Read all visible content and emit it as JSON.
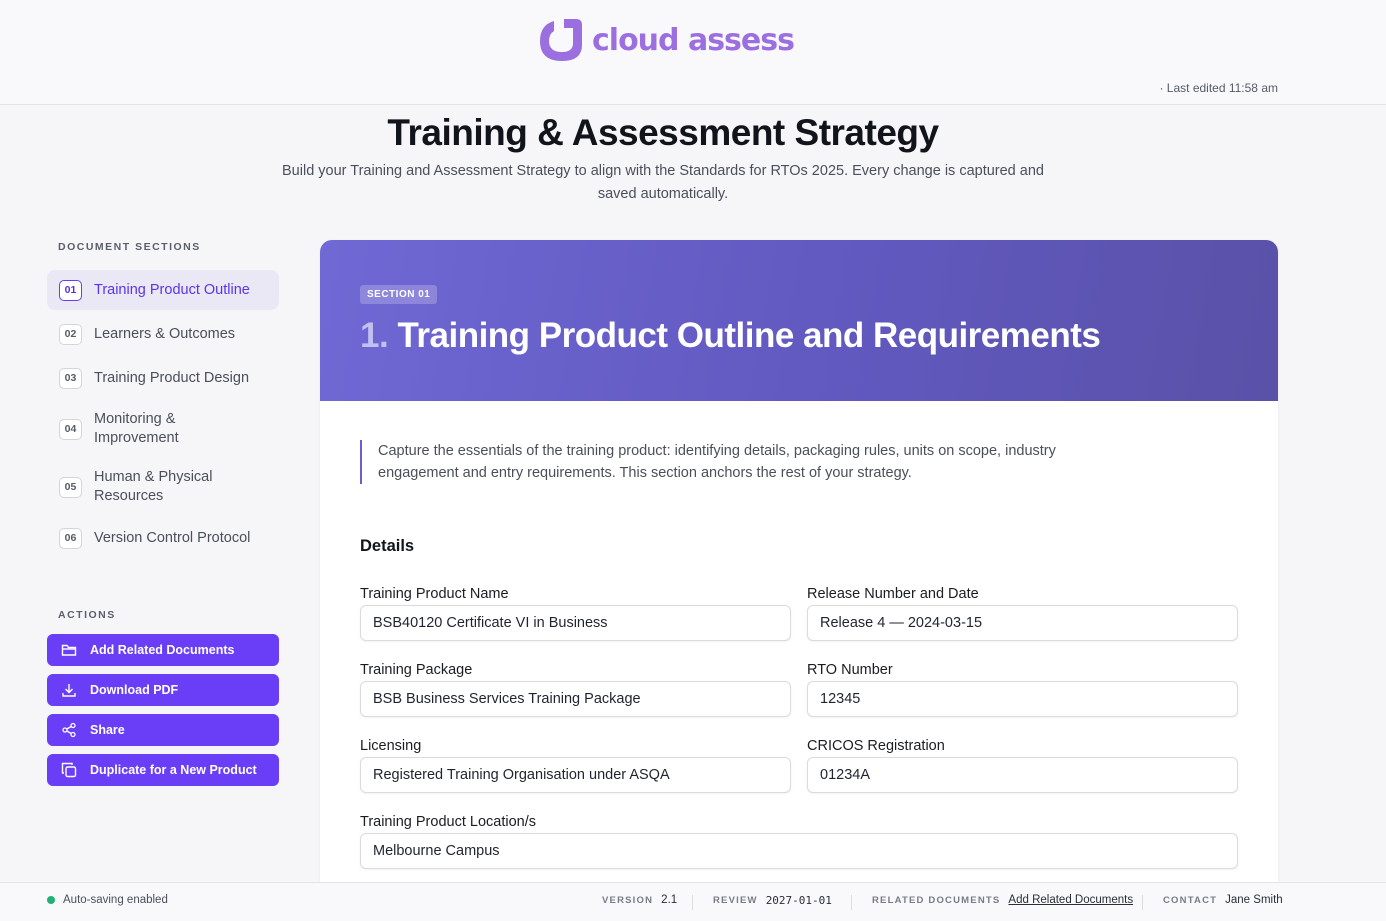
{
  "brand": {
    "name": "cloud assess",
    "color": "#9b6fe0"
  },
  "header": {
    "last_edited": "· Last edited 11:58 am"
  },
  "page": {
    "title": "Training & Assessment Strategy",
    "subtitle": "Build your Training and Assessment Strategy to align with the Standards for RTOs 2025. Every change is captured and saved automatically."
  },
  "sidebar": {
    "sections_heading": "DOCUMENT SECTIONS",
    "items": [
      {
        "num": "01",
        "label": "Training Product Outline",
        "active": true
      },
      {
        "num": "02",
        "label": "Learners & Outcomes"
      },
      {
        "num": "03",
        "label": "Training Product Design"
      },
      {
        "num": "04",
        "label": "Monitoring & Improvement"
      },
      {
        "num": "05",
        "label": "Human & Physical Resources"
      },
      {
        "num": "06",
        "label": "Version Control Protocol"
      }
    ],
    "actions_heading": "ACTIONS",
    "actions": [
      {
        "label": "Add Related Documents",
        "icon": "folder-icon"
      },
      {
        "label": "Download PDF",
        "icon": "download-icon"
      },
      {
        "label": "Share",
        "icon": "share-icon"
      },
      {
        "label": "Duplicate for a New Product",
        "icon": "copy-icon"
      }
    ],
    "accent": "#6a3df7"
  },
  "section": {
    "chip": "SECTION 01",
    "number": "1.",
    "title": "Training Product Outline and Requirements",
    "intro": "Capture the essentials of the training product: identifying details, packaging rules, units on scope, industry engagement and entry requirements. This section anchors the rest of your strategy.",
    "details_heading": "Details",
    "fields": {
      "product_name": {
        "label": "Training Product Name",
        "value": "BSB40120 Certificate VI in Business"
      },
      "release": {
        "label": "Release Number and Date",
        "value": "Release 4 — 2024-03-15"
      },
      "package": {
        "label": "Training Package",
        "value": "BSB Business Services Training Package"
      },
      "rto": {
        "label": "RTO Number",
        "value": "12345"
      },
      "licensing": {
        "label": "Licensing",
        "value": "Registered Training Organisation under ASQA"
      },
      "cricos": {
        "label": "CRICOS Registration",
        "value": "01234A"
      },
      "location": {
        "label": "Training Product Location/s",
        "value": "Melbourne Campus"
      }
    }
  },
  "footer": {
    "autosave": "Auto-saving enabled",
    "version_label": "VERSION",
    "version": "2.1",
    "review_label": "REVIEW",
    "review": "2027-01-01",
    "related_label": "RELATED DOCUMENTS",
    "related_link": "Add Related Documents",
    "contact_label": "CONTACT",
    "contact": "Jane Smith"
  }
}
